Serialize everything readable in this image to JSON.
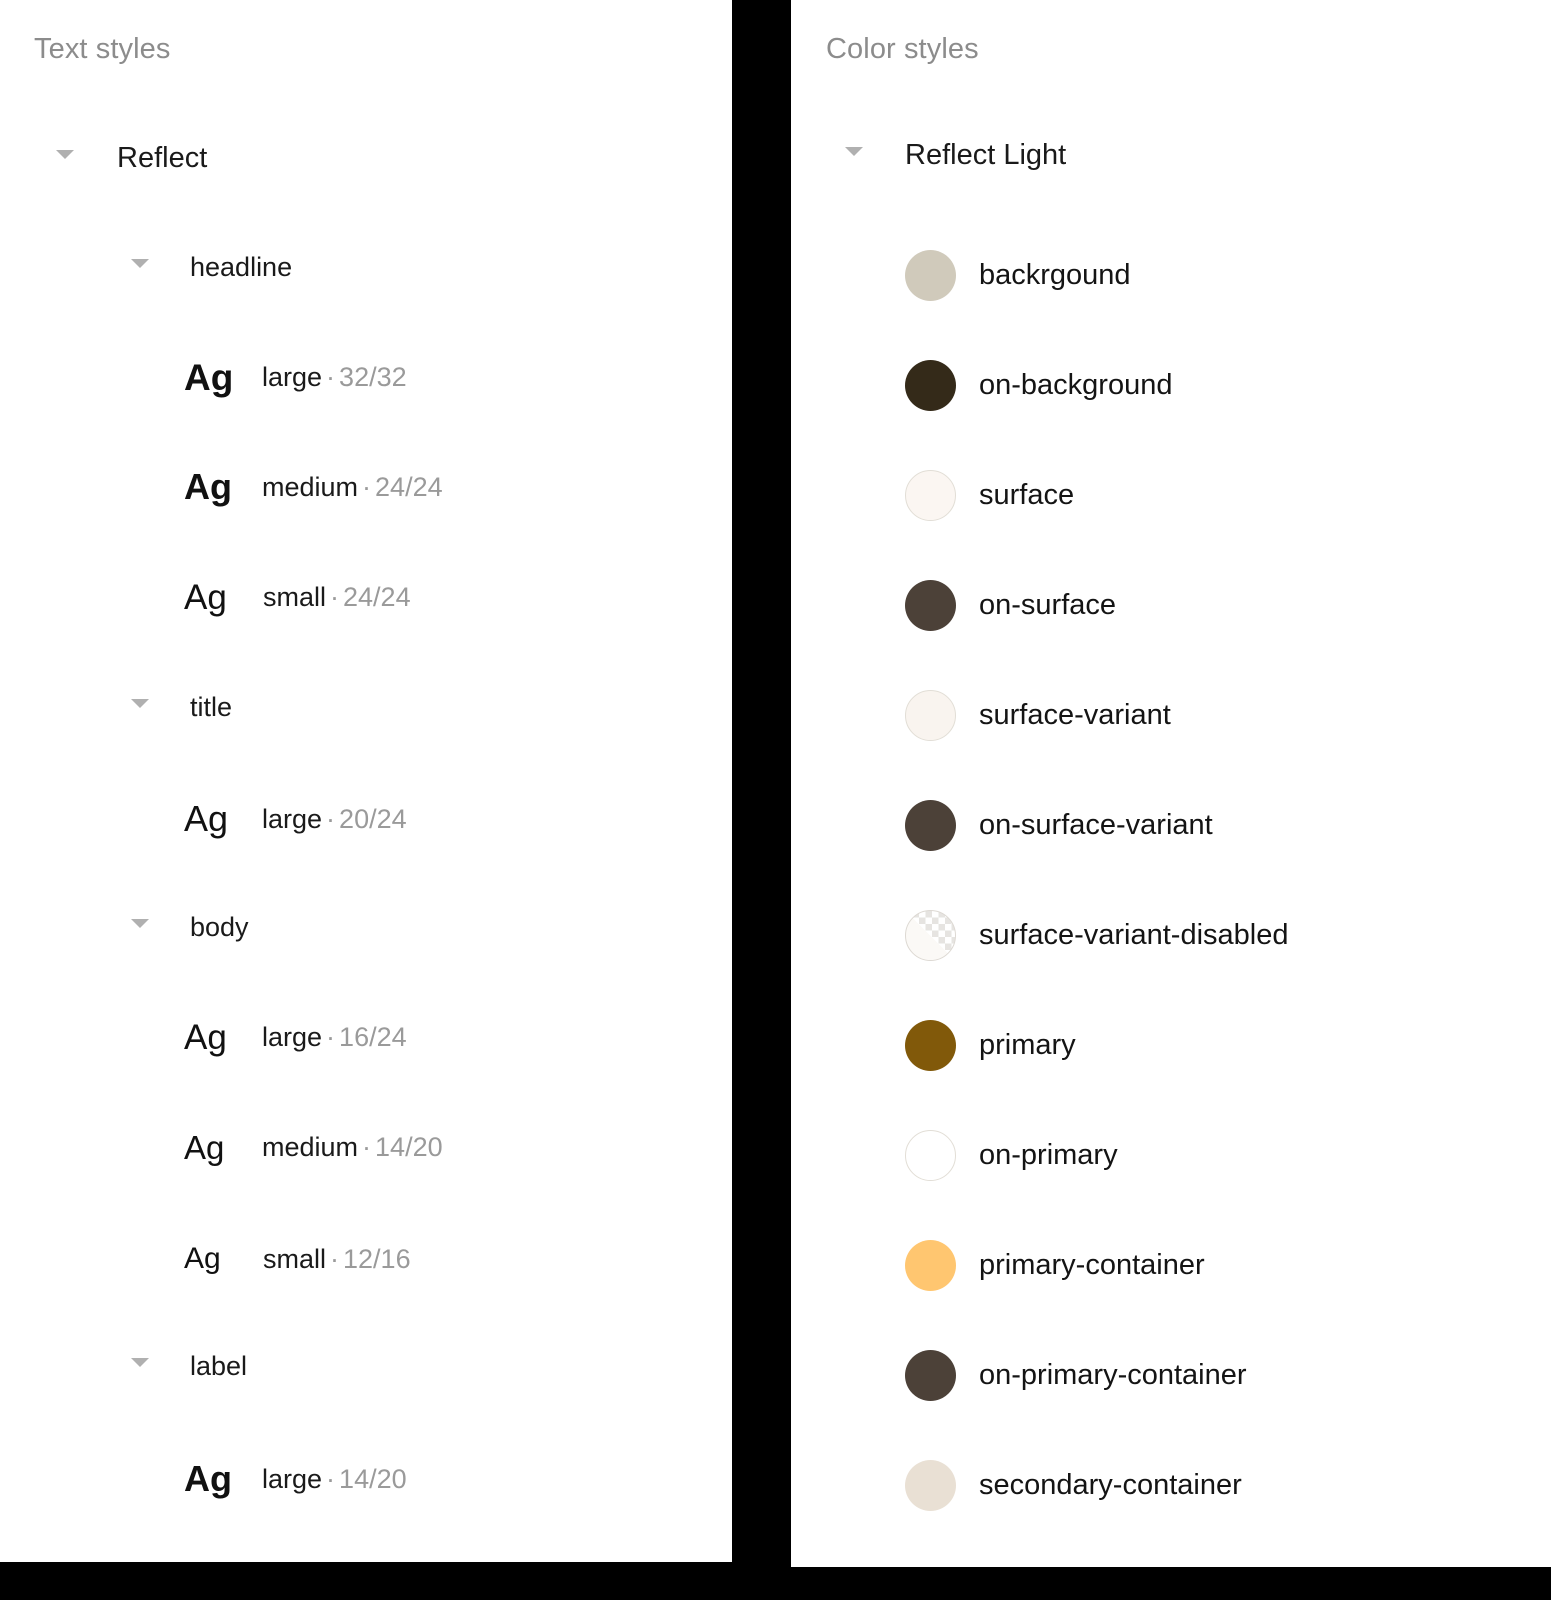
{
  "text_panel": {
    "heading": "Text styles",
    "root": {
      "label": "Reflect",
      "caret": "chevron-down-icon"
    },
    "groups": [
      {
        "label": "headline",
        "caret": "chevron-down-icon",
        "styles": [
          {
            "sample": "Ag",
            "name": "large",
            "separator": "·",
            "metrics": "32/32"
          },
          {
            "sample": "Ag",
            "name": "medium",
            "separator": "·",
            "metrics": "24/24"
          },
          {
            "sample": "Ag",
            "name": "small",
            "separator": "·",
            "metrics": "24/24"
          }
        ]
      },
      {
        "label": "title",
        "caret": "chevron-down-icon",
        "styles": [
          {
            "sample": "Ag",
            "name": "large",
            "separator": "·",
            "metrics": "20/24"
          }
        ]
      },
      {
        "label": "body",
        "caret": "chevron-down-icon",
        "styles": [
          {
            "sample": "Ag",
            "name": "large",
            "separator": "·",
            "metrics": "16/24"
          },
          {
            "sample": "Ag",
            "name": "medium",
            "separator": "·",
            "metrics": "14/20"
          },
          {
            "sample": "Ag",
            "name": "small",
            "separator": "·",
            "metrics": "12/16"
          }
        ]
      },
      {
        "label": "label",
        "caret": "chevron-down-icon",
        "styles": [
          {
            "sample": "Ag",
            "name": "large",
            "separator": "·",
            "metrics": "14/20"
          }
        ]
      }
    ]
  },
  "color_panel": {
    "heading": "Color styles",
    "root": {
      "label": "Reflect Light",
      "caret": "chevron-down-icon"
    },
    "swatches": [
      {
        "label": "backrgound",
        "color": "#d0cabb",
        "style": "solid"
      },
      {
        "label": "on-background",
        "color": "#342a19",
        "style": "solid"
      },
      {
        "label": "surface",
        "color": "#fbf6f2",
        "style": "ring"
      },
      {
        "label": "on-surface",
        "color": "#4c4138",
        "style": "solid"
      },
      {
        "label": "surface-variant",
        "color": "#f9f4ef",
        "style": "ring"
      },
      {
        "label": "on-surface-variant",
        "color": "#4c4138",
        "style": "solid"
      },
      {
        "label": "surface-variant-disabled",
        "color": "#f7f4f0",
        "style": "checker"
      },
      {
        "label": "primary",
        "color": "#81590a",
        "style": "solid"
      },
      {
        "label": "on-primary",
        "color": "#ffffff",
        "style": "ring"
      },
      {
        "label": "primary-container",
        "color": "#ffc670",
        "style": "solid"
      },
      {
        "label": "on-primary-container",
        "color": "#4c4138",
        "style": "solid"
      },
      {
        "label": "secondary-container",
        "color": "#e9e0d4",
        "style": "solid"
      }
    ]
  }
}
